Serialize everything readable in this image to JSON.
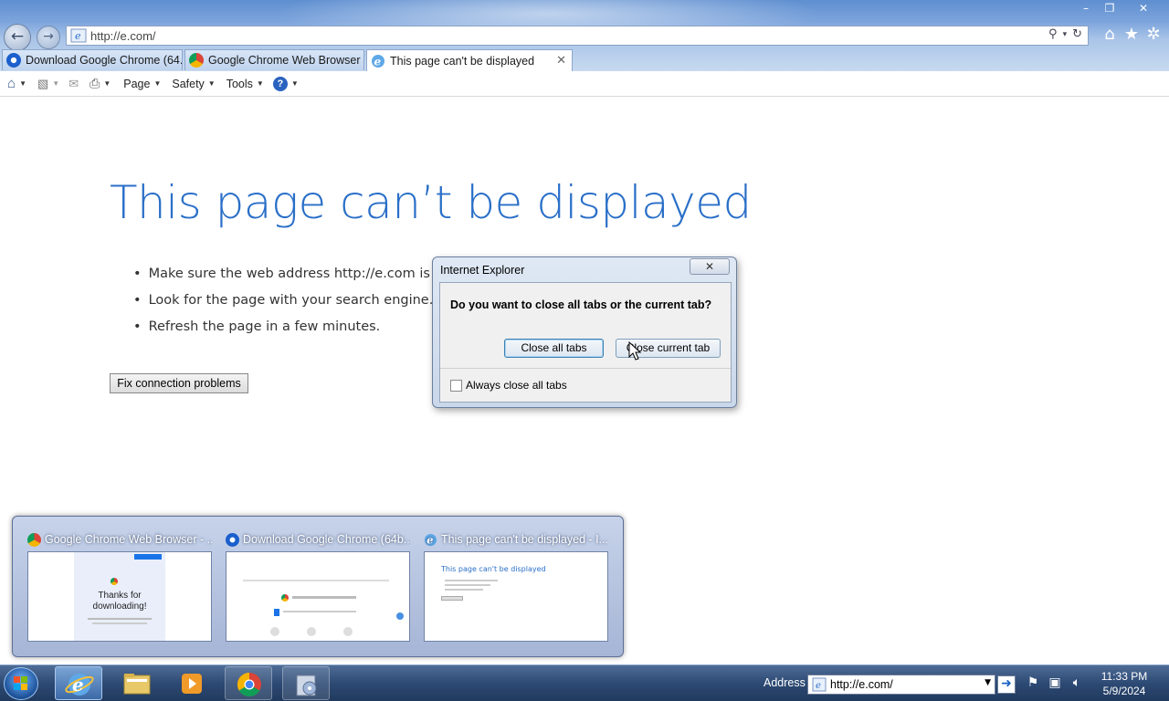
{
  "browser": {
    "address": "http://e.com/",
    "window_controls": {
      "minimize": "–",
      "restore": "❐",
      "close": "✕"
    },
    "tabs": [
      {
        "label": "Download Google Chrome (64...",
        "icon": "edge-blue-icon",
        "active": false
      },
      {
        "label": "Google Chrome Web Browser",
        "icon": "chrome-icon",
        "active": false
      },
      {
        "label": "This page can't be displayed",
        "icon": "ie-icon",
        "active": true,
        "close": "✕"
      }
    ],
    "command_bar": {
      "page": "Page",
      "safety": "Safety",
      "tools": "Tools"
    }
  },
  "page": {
    "heading": "This page can’t be displayed",
    "tips": [
      "Make sure the web address http://e.com is corr",
      "Look for the page with your search engine.",
      "Refresh the page in a few minutes."
    ],
    "fix_button": "Fix connection problems"
  },
  "dialog": {
    "title": "Internet Explorer",
    "close": "✕",
    "question": "Do you want to close all tabs or the current tab?",
    "close_all": "Close all tabs",
    "close_current": "Close current tab",
    "checkbox_label": "Always close all tabs",
    "checkbox_checked": false
  },
  "thumbnails": [
    {
      "title": "Google Chrome Web Browser - ...",
      "icon": "chrome-icon",
      "preview_text": "Thanks for downloading!"
    },
    {
      "title": "Download Google Chrome (64b...",
      "icon": "edge-blue-icon",
      "preview_text": ""
    },
    {
      "title": "This page can't be displayed - I...",
      "icon": "ie-icon",
      "preview_text": "This page can't be displayed"
    }
  ],
  "taskbar": {
    "address_label": "Address",
    "address_value": "http://e.com/",
    "time": "11:33 PM",
    "date": "5/9/2024"
  },
  "colors": {
    "heading_blue": "#2a6fc8",
    "taskbar": "#2d4a74"
  }
}
